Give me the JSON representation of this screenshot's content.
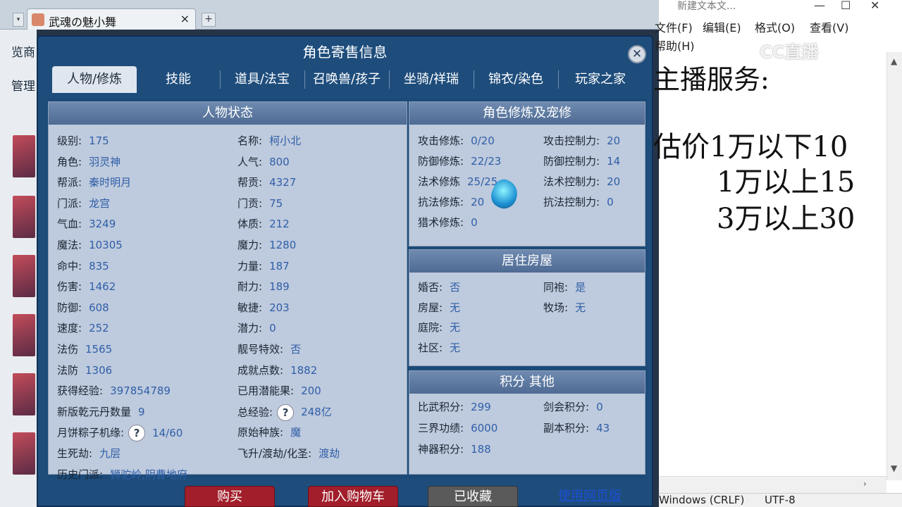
{
  "browser": {
    "tab_title": "武魂の魅小舞",
    "tab_close": "×",
    "new_tab": "+",
    "left_text_1": "览商",
    "left_text_2": "管理"
  },
  "dialog": {
    "title": "角色寄售信息",
    "close": "✕",
    "tabs": [
      "人物/修炼",
      "技能",
      "道具/法宝",
      "召唤兽/孩子",
      "坐骑/祥瑞",
      "锦衣/染色",
      "玩家之家"
    ],
    "active_tab": "人物/修炼"
  },
  "status": {
    "header": "人物状态",
    "left": [
      {
        "label": "级别:",
        "value": "175"
      },
      {
        "label": "角色:",
        "value": "羽灵神"
      },
      {
        "label": "帮派:",
        "value": "秦时明月"
      },
      {
        "label": "门派:",
        "value": "龙宫"
      },
      {
        "label": "气血:",
        "value": "3249"
      },
      {
        "label": "魔法:",
        "value": "10305"
      },
      {
        "label": "命中:",
        "value": "835"
      },
      {
        "label": "伤害:",
        "value": "1462"
      },
      {
        "label": "防御:",
        "value": "608"
      },
      {
        "label": "速度:",
        "value": "252"
      },
      {
        "label": "法伤",
        "value": "1565"
      },
      {
        "label": "法防",
        "value": "1306"
      },
      {
        "label": "获得经验:",
        "value": "397854789"
      },
      {
        "label": "新版乾元丹数量",
        "value": "9"
      },
      {
        "label": "月饼粽子机缘:",
        "value": "14/60"
      },
      {
        "label": "生死劫:",
        "value": "九层"
      },
      {
        "label": "历史门派:",
        "value": "狮驼岭,阴曹地府"
      }
    ],
    "right": [
      {
        "label": "名称:",
        "value": "柯小北"
      },
      {
        "label": "人气:",
        "value": "800"
      },
      {
        "label": "帮贡:",
        "value": "4327"
      },
      {
        "label": "门贡:",
        "value": "75"
      },
      {
        "label": "体质:",
        "value": "212"
      },
      {
        "label": "魔力:",
        "value": "1280"
      },
      {
        "label": "力量:",
        "value": "187"
      },
      {
        "label": "耐力:",
        "value": "189"
      },
      {
        "label": "敏捷:",
        "value": "203"
      },
      {
        "label": "潜力:",
        "value": "0"
      },
      {
        "label": "靓号特效:",
        "value": "否"
      },
      {
        "label": "成就点数:",
        "value": "1882"
      },
      {
        "label": "已用潜能果:",
        "value": "200"
      },
      {
        "label": "总经验:",
        "value": "248亿"
      },
      {
        "label": "原始种族:",
        "value": "魔"
      },
      {
        "label": "飞升/渡劫/化圣:",
        "value": "渡劫"
      }
    ],
    "help_glyph": "?"
  },
  "cultivation": {
    "header": "角色修炼及宠修",
    "left": [
      {
        "label": "攻击修炼:",
        "value": "0/20"
      },
      {
        "label": "防御修炼:",
        "value": "22/23"
      },
      {
        "label": "法术修炼",
        "value": "25/25"
      },
      {
        "label": "抗法修炼:",
        "value": "20"
      },
      {
        "label": "猎术修炼:",
        "value": "0"
      }
    ],
    "right": [
      {
        "label": "攻击控制力:",
        "value": "20"
      },
      {
        "label": "防御控制力:",
        "value": "14"
      },
      {
        "label": "法术控制力:",
        "value": "20"
      },
      {
        "label": "抗法控制力:",
        "value": "0"
      }
    ]
  },
  "house": {
    "header": "居住房屋",
    "left": [
      {
        "label": "婚否:",
        "value": "否"
      },
      {
        "label": "房屋:",
        "value": "无"
      },
      {
        "label": "庭院:",
        "value": "无"
      },
      {
        "label": "社区:",
        "value": "无"
      }
    ],
    "right": [
      {
        "label": "同袍:",
        "value": "是"
      },
      {
        "label": "牧场:",
        "value": "无"
      }
    ]
  },
  "points": {
    "header": "积分 其他",
    "left": [
      {
        "label": "比武积分:",
        "value": "299"
      },
      {
        "label": "三界功绩:",
        "value": "6000"
      },
      {
        "label": "神器积分:",
        "value": "188"
      }
    ],
    "right": [
      {
        "label": "剑会积分:",
        "value": "0"
      },
      {
        "label": "副本积分:",
        "value": "43"
      }
    ]
  },
  "actions": {
    "buy": "购买",
    "add_cart": "加入购物车",
    "favorited": "已收藏",
    "web_version": "使用网页版"
  },
  "notepad": {
    "title": "新建文本文...",
    "minimize": "—",
    "maximize": "☐",
    "close": "✕",
    "menu": [
      "文件(F)",
      "编辑(E)",
      "格式(O)",
      "查看(V)",
      "帮助(H)"
    ],
    "lines": [
      "主播服务:",
      "估价1万以下10",
      "1万以上15",
      "3万以上30"
    ],
    "status_encoding_1": "Windows (CRLF)",
    "status_encoding_2": "UTF-8",
    "watermark": "CC直播"
  }
}
